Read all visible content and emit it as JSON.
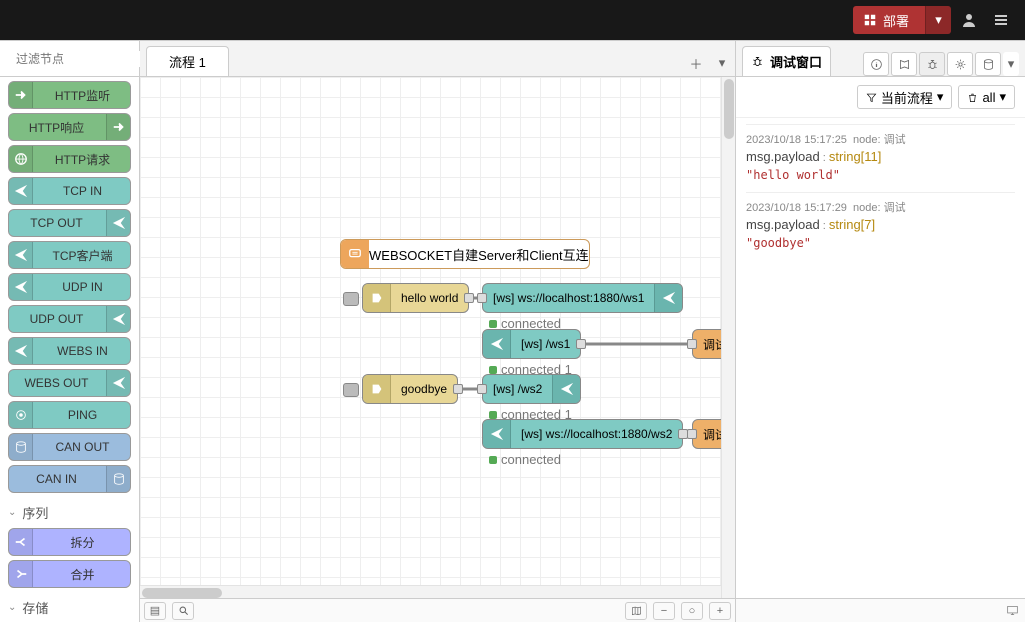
{
  "header": {
    "deploy_label": "部署",
    "deploy_icon": "deploy-icon",
    "caret_icon": "▾",
    "user_icon": "user-icon",
    "menu_icon": "menu-icon"
  },
  "palette": {
    "search_placeholder": "过滤节点",
    "nodes": [
      {
        "label": "HTTP监听",
        "color": "#7ebd83",
        "icon": "arrow-in",
        "side": "left"
      },
      {
        "label": "HTTP响应",
        "color": "#7ebd83",
        "icon": "arrow-out",
        "side": "right"
      },
      {
        "label": "HTTP请求",
        "color": "#7ebd83",
        "icon": "globe",
        "side": "left"
      },
      {
        "label": "TCP IN",
        "color": "#7fcac3",
        "icon": "send",
        "side": "left"
      },
      {
        "label": "TCP OUT",
        "color": "#7fcac3",
        "icon": "send",
        "side": "right"
      },
      {
        "label": "TCP客户端",
        "color": "#7fcac3",
        "icon": "send",
        "side": "left"
      },
      {
        "label": "UDP IN",
        "color": "#7fcac3",
        "icon": "send",
        "side": "left"
      },
      {
        "label": "UDP OUT",
        "color": "#7fcac3",
        "icon": "send",
        "side": "right"
      },
      {
        "label": "WEBS IN",
        "color": "#7fcac3",
        "icon": "send",
        "side": "left"
      },
      {
        "label": "WEBS OUT",
        "color": "#7fcac3",
        "icon": "send",
        "side": "right"
      },
      {
        "label": "PING",
        "color": "#7fcac3",
        "icon": "ping",
        "side": "left"
      },
      {
        "label": "CAN OUT",
        "color": "#9bbcdd",
        "icon": "can",
        "side": "left"
      },
      {
        "label": "CAN IN",
        "color": "#9bbcdd",
        "icon": "can",
        "side": "right"
      }
    ],
    "cat_seq": "序列",
    "seq_nodes": [
      {
        "label": "拆分",
        "color": "#aeb3ff",
        "icon": "split"
      },
      {
        "label": "合并",
        "color": "#aeb3ff",
        "icon": "join"
      }
    ],
    "cat_store": "存储"
  },
  "workspace": {
    "tab": "流程 1",
    "comment": "WEBSOCKET自建Server和Client互连",
    "nodes": {
      "inject1": {
        "label": "hello world"
      },
      "wsOut1": {
        "label": "[ws] ws://localhost:1880/ws1",
        "status": "connected"
      },
      "wsIn1": {
        "label": "[ws] /ws1",
        "status": "connected 1"
      },
      "debug1": {
        "label": "调试"
      },
      "inject2": {
        "label": "goodbye"
      },
      "wsOut2": {
        "label": "[ws] /ws2",
        "status": "connected 1"
      },
      "wsIn2": {
        "label": "[ws] ws://localhost:1880/ws2",
        "status": "connected"
      },
      "debug2": {
        "label": "调试"
      }
    }
  },
  "sidebar": {
    "title": "调试窗口",
    "filter_label": "当前流程",
    "clear_label": "all",
    "messages": [
      {
        "ts": "2023/10/18 15:17:25",
        "src": "node: 调试",
        "path": "msg.payload",
        "type": "string[11]",
        "value": "\"hello world\""
      },
      {
        "ts": "2023/10/18 15:17:29",
        "src": "node: 调试",
        "path": "msg.payload",
        "type": "string[7]",
        "value": "\"goodbye\""
      }
    ]
  }
}
